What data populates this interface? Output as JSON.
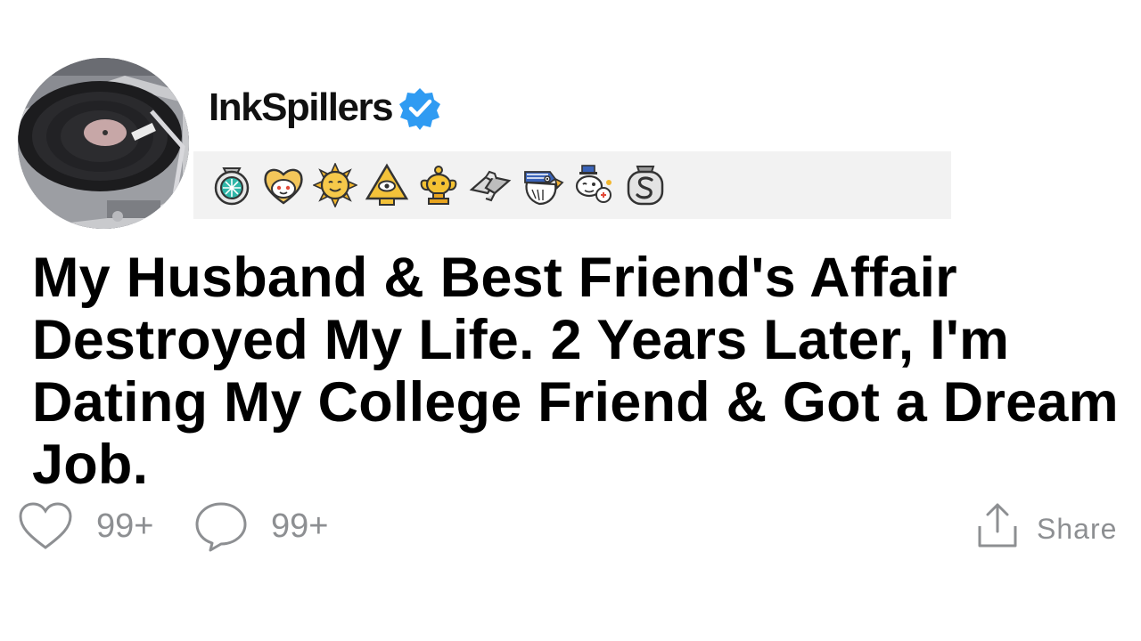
{
  "author": {
    "username": "InkSpillers",
    "verified": true,
    "avatar": "record-player-icon",
    "verified_color": "#2f9bf2"
  },
  "awards": [
    {
      "icon": "helpful-award-icon"
    },
    {
      "icon": "wholesome-award-icon"
    },
    {
      "icon": "sunny-award-icon"
    },
    {
      "icon": "eye-pyramid-award-icon"
    },
    {
      "icon": "gold-award-icon"
    },
    {
      "icon": "fistbump-award-icon"
    },
    {
      "icon": "eagle-award-icon"
    },
    {
      "icon": "snoo-wink-award-icon"
    },
    {
      "icon": "silver-coin-award-icon"
    }
  ],
  "post": {
    "title": "My Husband & Best Friend's Affair Destroyed My Life. 2 Years Later, I'm Dating My College Friend & Got a Dream Job."
  },
  "actions": {
    "likes": "99+",
    "comments": "99+",
    "share_label": "Share",
    "icon_color": "#8d8f92"
  }
}
